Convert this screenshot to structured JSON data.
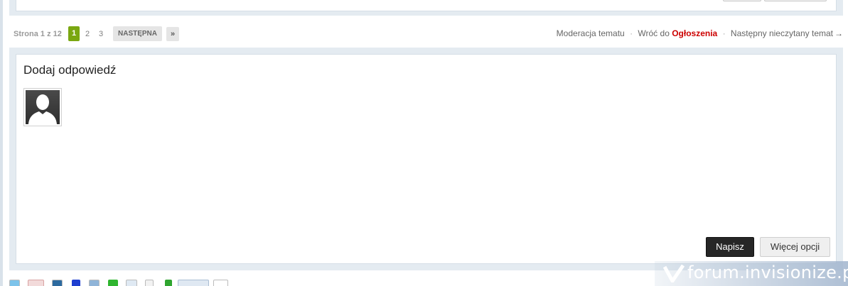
{
  "pagination": {
    "label": "Strona 1 z 12",
    "pages": [
      "1",
      "2",
      "3"
    ],
    "current": "1",
    "next_label": "NASTĘPNA",
    "last_label": "»"
  },
  "topic_links": {
    "moderation": "Moderacja tematu",
    "back_prefix": "Wróć do",
    "forum_name": "Ogłoszenia",
    "next_unread": "Następny nieczytany temat",
    "arrow": "→",
    "separator": "·"
  },
  "reply": {
    "title": "Dodaj odpowiedź",
    "submit_label": "Napisz",
    "more_options_label": "Więcej opcji"
  },
  "share_icons": [
    "twitter-icon",
    "google-plus-icon",
    "linkedin-icon",
    "delicious-icon",
    "digg-icon",
    "myspace-icon",
    "email-icon",
    "print-icon",
    "add-icon",
    "share-button",
    "like-icon"
  ],
  "watermark": {
    "text": "forum.invisionize.pl"
  },
  "colors": {
    "accent_green": "#7aa711",
    "forum_link_red": "#cc0000",
    "panel_bg": "#e4ebf1",
    "primary_button": "#262626"
  }
}
